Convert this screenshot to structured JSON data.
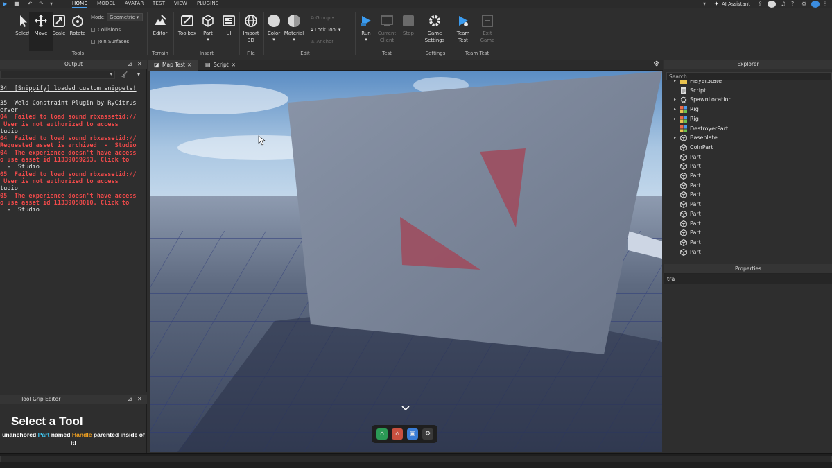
{
  "menubar": {
    "tabs": [
      "HOME",
      "MODEL",
      "AVATAR",
      "TEST",
      "VIEW",
      "PLUGINS"
    ],
    "active_tab": "HOME",
    "ai_assistant": "AI Assistant"
  },
  "ribbon": {
    "tools": {
      "select": "Select",
      "move": "Move",
      "scale": "Scale",
      "rotate": "Rotate",
      "mode_label": "Mode:",
      "mode_value": "Geometric",
      "collisions": "Collisions",
      "join_surfaces": "Join Surfaces",
      "group_label": "Tools"
    },
    "terrain": {
      "editor": "Editor",
      "group_label": "Terrain"
    },
    "insert": {
      "toolbox": "Toolbox",
      "part": "Part",
      "ui": "UI",
      "group_label": "Insert"
    },
    "file": {
      "import3d": "Import\n3D",
      "group_label": "File"
    },
    "edit": {
      "color": "Color",
      "material": "Material",
      "group": "Group",
      "lock_tool": "Lock Tool",
      "anchor": "Anchor",
      "group_label": "Edit"
    },
    "test": {
      "run": "Run",
      "current_client": "Current\nClient",
      "stop": "Stop",
      "group_label": "Test"
    },
    "settings": {
      "game_settings": "Game\nSettings",
      "group_label": "Settings"
    },
    "team_test": {
      "team_test": "Team\nTest",
      "exit_game": "Exit\nGame",
      "group_label": "Team Test"
    }
  },
  "output": {
    "title": "Output",
    "lines": [
      {
        "text": "34  [Snippify] loaded custom snippets!",
        "style": "under"
      },
      {
        "text": "",
        "style": "white"
      },
      {
        "text": "35  Weld Constraint Plugin by RyCitrus",
        "style": "white"
      },
      {
        "text": "erver",
        "style": "white"
      },
      {
        "text": "04  Failed to load sound rbxassetid://",
        "style": "red"
      },
      {
        "text": " User is not authorized to access",
        "style": "red"
      },
      {
        "text": "tudio",
        "style": "white"
      },
      {
        "text": "04  Failed to load sound rbxassetid://",
        "style": "red"
      },
      {
        "text": "Requested asset is archived  -  Studio",
        "style": "red"
      },
      {
        "text": "04  The experience doesn't have access",
        "style": "red"
      },
      {
        "text": "o use asset id 11339059253. Click to",
        "style": "red"
      },
      {
        "text": "  -  Studio",
        "style": "white"
      },
      {
        "text": "05  Failed to load sound rbxassetid://",
        "style": "red"
      },
      {
        "text": " User is not authorized to access",
        "style": "red"
      },
      {
        "text": "tudio",
        "style": "white"
      },
      {
        "text": "05  The experience doesn't have access",
        "style": "red"
      },
      {
        "text": "o use asset id 11339058010. Click to",
        "style": "red"
      },
      {
        "text": "  -  Studio",
        "style": "white"
      }
    ]
  },
  "tool_grip": {
    "title": "Tool Grip Editor",
    "heading": "Select a Tool",
    "desc_prefix": "unanchored ",
    "desc_part": "Part",
    "desc_mid": " named ",
    "desc_handle": "Handle",
    "desc_suffix": " parented inside of",
    "desc_end": "it!"
  },
  "doc_tabs": [
    {
      "label": "Map Test",
      "active": true
    },
    {
      "label": "Script",
      "active": false
    }
  ],
  "explorer": {
    "title": "Explorer",
    "search_placeholder": "Search",
    "items": [
      {
        "name": "PlayerState",
        "icon": "folder-icon",
        "expandable": true
      },
      {
        "name": "Script",
        "icon": "script-icon",
        "expandable": false
      },
      {
        "name": "SpawnLocation",
        "icon": "spawn-icon",
        "expandable": true
      },
      {
        "name": "Rig",
        "icon": "model-icon",
        "expandable": true
      },
      {
        "name": "Rig",
        "icon": "model-icon",
        "expandable": true
      },
      {
        "name": "DestroyerPart",
        "icon": "model-icon",
        "expandable": false
      },
      {
        "name": "Baseplate",
        "icon": "part-icon",
        "expandable": true
      },
      {
        "name": "CoinPart",
        "icon": "part-icon",
        "expandable": false
      },
      {
        "name": "Part",
        "icon": "part-icon",
        "expandable": false
      },
      {
        "name": "Part",
        "icon": "part-icon",
        "expandable": false
      },
      {
        "name": "Part",
        "icon": "part-icon",
        "expandable": false
      },
      {
        "name": "Part",
        "icon": "part-icon",
        "expandable": false
      },
      {
        "name": "Part",
        "icon": "part-icon",
        "expandable": false
      },
      {
        "name": "Part",
        "icon": "part-icon",
        "expandable": false
      },
      {
        "name": "Part",
        "icon": "part-icon",
        "expandable": false
      },
      {
        "name": "Part",
        "icon": "part-icon",
        "expandable": false
      },
      {
        "name": "Part",
        "icon": "part-icon",
        "expandable": false
      },
      {
        "name": "Part",
        "icon": "part-icon",
        "expandable": false
      },
      {
        "name": "Part",
        "icon": "part-icon",
        "expandable": false
      }
    ]
  },
  "properties": {
    "title": "Properties",
    "filter_value": "tra"
  },
  "colors": {
    "accent": "#4aa0f0",
    "error": "#f04a4a",
    "part_cyan": "#3fc6f0",
    "handle_orange": "#f0a020"
  }
}
